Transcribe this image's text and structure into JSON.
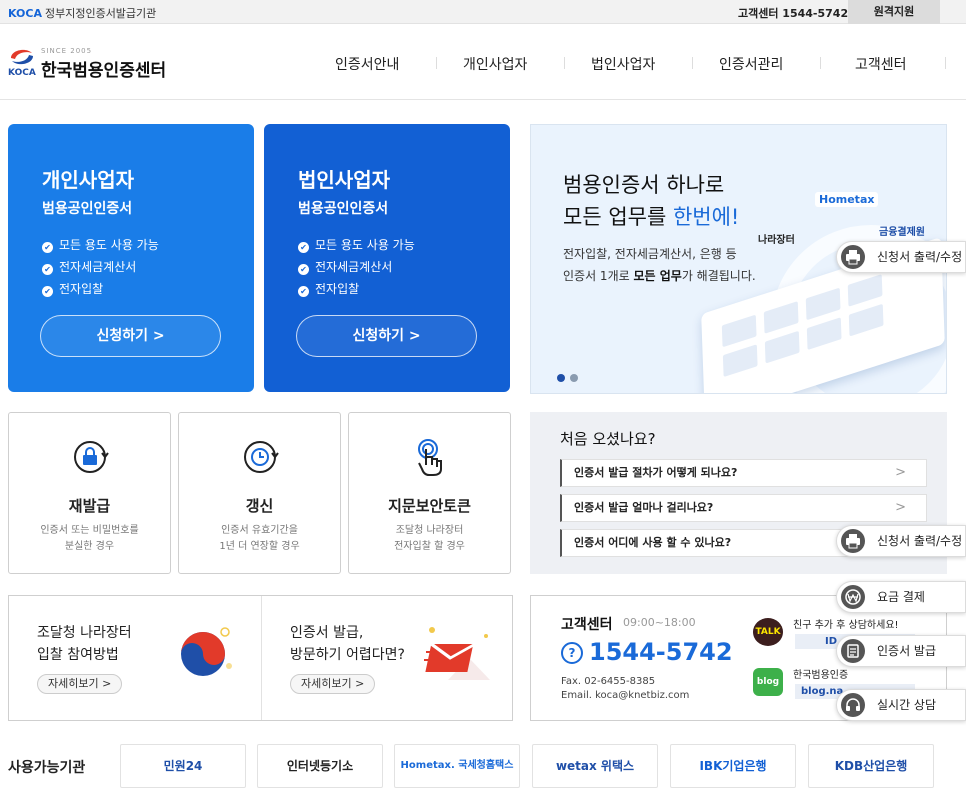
{
  "topbar": {
    "brand": "KOCA",
    "org": "정부지정인증서발급기관",
    "cs": "고객센터 1544-5742",
    "remote": "원격지원"
  },
  "header": {
    "logo_since": "SINCE 2005",
    "logo_koca": "KOCA",
    "logo_name": "한국범용인증센터",
    "nav": [
      "인증서안내",
      "개인사업자",
      "법인사업자",
      "인증서관리",
      "고객센터"
    ]
  },
  "cards": [
    {
      "title": "개인사업자",
      "subtitle": "범용공인인증서",
      "features": [
        "모든 용도 사용 가능",
        "전자세금계산서",
        "전자입찰"
      ],
      "button": "신청하기 >",
      "color": "#1a7de8"
    },
    {
      "title": "법인사업자",
      "subtitle": "범용공인인증서",
      "features": [
        "모든 용도 사용 가능",
        "전자세금계산서",
        "전자입찰"
      ],
      "button": "신청하기 >",
      "color": "#1260d4"
    }
  ],
  "banner": {
    "line1": "범용인증서 하나로",
    "line2_prefix": "모든 업무를 ",
    "line2_highlight": "한번에!",
    "desc1": "전자입찰, 전자세금계산서, 은행 등",
    "desc2_prefix": "인증서 1개로 ",
    "desc2_bold": "모든 업무",
    "desc2_suffix": "가 해결됩니다.",
    "logo_hometax": "Hometax",
    "logo_nara": "나라장터",
    "logo_kfa": "금융결제원",
    "dot_active": "#1f4fa8",
    "dot_inactive": "#8a9bb0"
  },
  "services": [
    {
      "title": "재발급",
      "desc1": "인증서 또는 비밀번호를",
      "desc2": "분실한 경우",
      "icon": "lock-refresh-icon"
    },
    {
      "title": "갱신",
      "desc1": "인증서 유효기간을",
      "desc2": "1년 더 연장할 경우",
      "icon": "clock-refresh-icon"
    },
    {
      "title": "지문보안토큰",
      "desc1": "조달청 나라장터",
      "desc2": "전자입찰 할 경우",
      "icon": "fingerprint-touch-icon"
    }
  ],
  "faq": {
    "title": "처음 오셨나요?",
    "items": [
      "인증서 발급 절차가 어떻게 되나요?",
      "인증서 발급 얼마나 걸리나요?",
      "인증서 어디에 사용 할 수 있나요?"
    ],
    "arrow": ">"
  },
  "promo": [
    {
      "line1": "조달청 나라장터",
      "line2": "입찰 참여방법",
      "more": "자세히보기 >"
    },
    {
      "line1": "인증서 발급,",
      "line2": "방문하기 어렵다면?",
      "more": "자세히보기 >"
    }
  ],
  "customer": {
    "title": "고객센터",
    "hours": "09:00~18:00",
    "phone": "1544-5742",
    "fax": "Fax. 02-6455-8385",
    "email": "Email. koca@knetbiz.com",
    "talk_label": "TALK",
    "talk_text": "친구 추가 후 상담하세요!",
    "talk_id": "ID",
    "blog_label": "blog",
    "blog_text": "한국범용인증",
    "blog_url": "blog.na"
  },
  "agencies": {
    "title": "사용가능기관",
    "items": [
      {
        "label": "민원24",
        "color": "#1f4fa8"
      },
      {
        "label": "인터넷등기소",
        "color": "#222222"
      },
      {
        "label": "Hometax. 국세청홈택스",
        "color": "#1a6ad8"
      },
      {
        "label": "wetax 위택스",
        "color": "#1f4fa8"
      },
      {
        "label": "IBK기업은행",
        "color": "#1260d4"
      },
      {
        "label": "KDB산업은행",
        "color": "#1f4fa8"
      }
    ]
  },
  "floating": [
    {
      "label": "신청서 출력/수정",
      "icon": "printer-icon"
    },
    {
      "label": "신청서 출력/수정",
      "icon": "printer-icon"
    },
    {
      "label": "요금 결제",
      "icon": "won-coin-icon"
    },
    {
      "label": "인증서 발급",
      "icon": "document-icon"
    },
    {
      "label": "실시간 상담",
      "icon": "headset-icon"
    }
  ]
}
